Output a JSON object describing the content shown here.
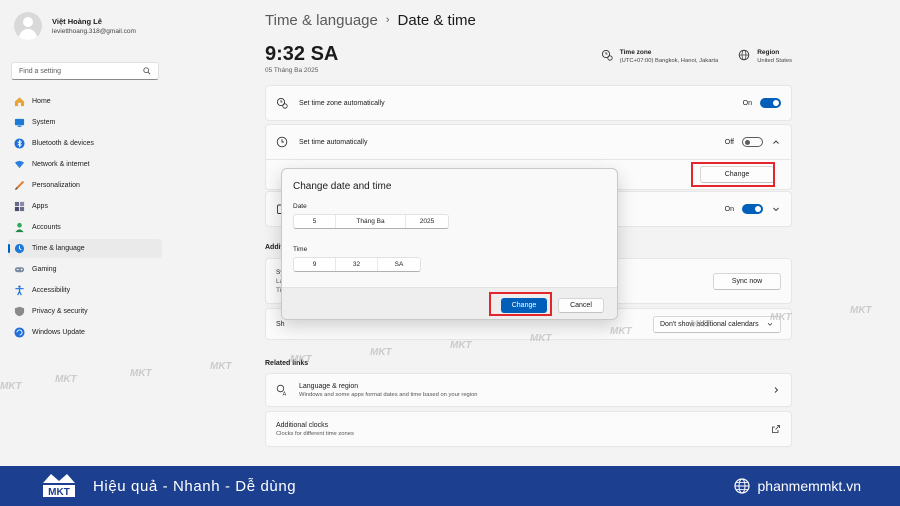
{
  "profile": {
    "name": "Việt Hoàng Lê",
    "email": "levietthoang.318@gmail.com"
  },
  "search": {
    "placeholder": "Find a setting"
  },
  "nav": [
    {
      "label": "Home",
      "icon": "home-icon"
    },
    {
      "label": "System",
      "icon": "system-icon"
    },
    {
      "label": "Bluetooth & devices",
      "icon": "bluetooth-icon"
    },
    {
      "label": "Network & internet",
      "icon": "network-icon"
    },
    {
      "label": "Personalization",
      "icon": "personalization-icon"
    },
    {
      "label": "Apps",
      "icon": "apps-icon"
    },
    {
      "label": "Accounts",
      "icon": "accounts-icon"
    },
    {
      "label": "Time & language",
      "icon": "time-language-icon",
      "active": true
    },
    {
      "label": "Gaming",
      "icon": "gaming-icon"
    },
    {
      "label": "Accessibility",
      "icon": "accessibility-icon"
    },
    {
      "label": "Privacy & security",
      "icon": "privacy-icon"
    },
    {
      "label": "Windows Update",
      "icon": "update-icon"
    }
  ],
  "header": {
    "parent": "Time & language",
    "separator": "›",
    "current": "Date & time"
  },
  "clock": {
    "time": "9:32 SA",
    "date": "05 Tháng Ba 2025"
  },
  "timezone": {
    "title": "Time zone",
    "value": "(UTC+07:00) Bangkok, Hanoi, Jakarta"
  },
  "region": {
    "title": "Region",
    "value": "United States"
  },
  "settings": {
    "tz_auto": {
      "label": "Set time zone automatically",
      "state": "On"
    },
    "time_auto": {
      "label": "Set time automatically",
      "state": "Off"
    },
    "manual_change": {
      "button": "Change"
    },
    "dst_state": "On",
    "sync_button": "Sync now",
    "calendar_select": "Don't show additional calendars"
  },
  "section_additional": "Additi",
  "section_related": "Related links",
  "partial": {
    "sync_title": "Sy",
    "sync_line1": "La",
    "sync_line2": "Ti",
    "cal_label": "Sh"
  },
  "related": [
    {
      "title": "Language & region",
      "desc": "Windows and some apps format dates and time based on your region",
      "icon": "language-region-icon"
    },
    {
      "title": "Additional clocks",
      "desc": "Clocks for different time zones",
      "icon": "external-link-icon"
    }
  ],
  "dialog": {
    "title": "Change date and time",
    "date_label": "Date",
    "day": "5",
    "month": "Tháng Ba",
    "year": "2025",
    "time_label": "Time",
    "hour": "9",
    "minute": "32",
    "ampm": "SA",
    "change": "Change",
    "cancel": "Cancel"
  },
  "watermark": "MKT",
  "banner": {
    "logo": "MKT",
    "tagline": "Hiệu quả - Nhanh - Dễ dùng",
    "site": "phanmemmkt.vn"
  },
  "colors": {
    "accent": "#005fb8",
    "highlight": "#e3262c",
    "banner": "#1d3f8f"
  }
}
